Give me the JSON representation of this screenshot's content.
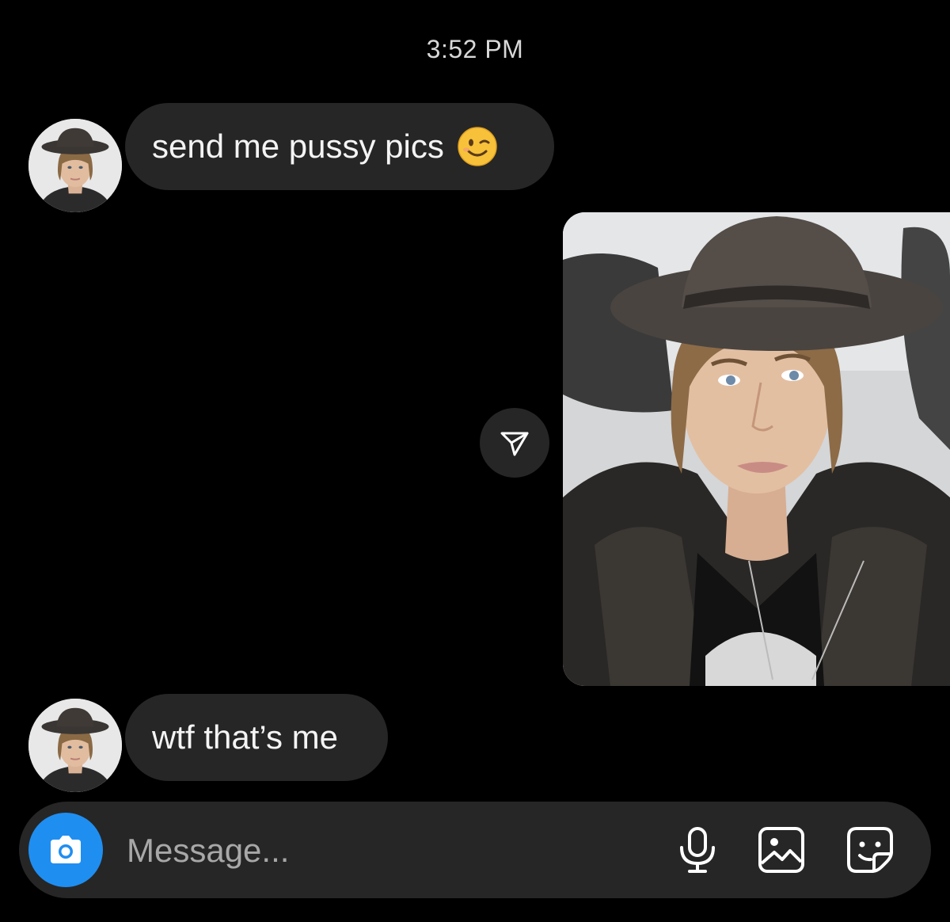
{
  "timestamp": "3:52 PM",
  "messages": [
    {
      "text": "send me pussy pics",
      "emoji": "winking-face"
    },
    {
      "text": "wtf that’s me"
    }
  ],
  "composer": {
    "placeholder": "Message..."
  },
  "colors": {
    "background": "#000000",
    "bubble": "#262626",
    "accent": "#1f8ef1"
  },
  "icons": [
    "camera-icon",
    "microphone-icon",
    "gallery-icon",
    "sticker-icon",
    "send-icon"
  ]
}
